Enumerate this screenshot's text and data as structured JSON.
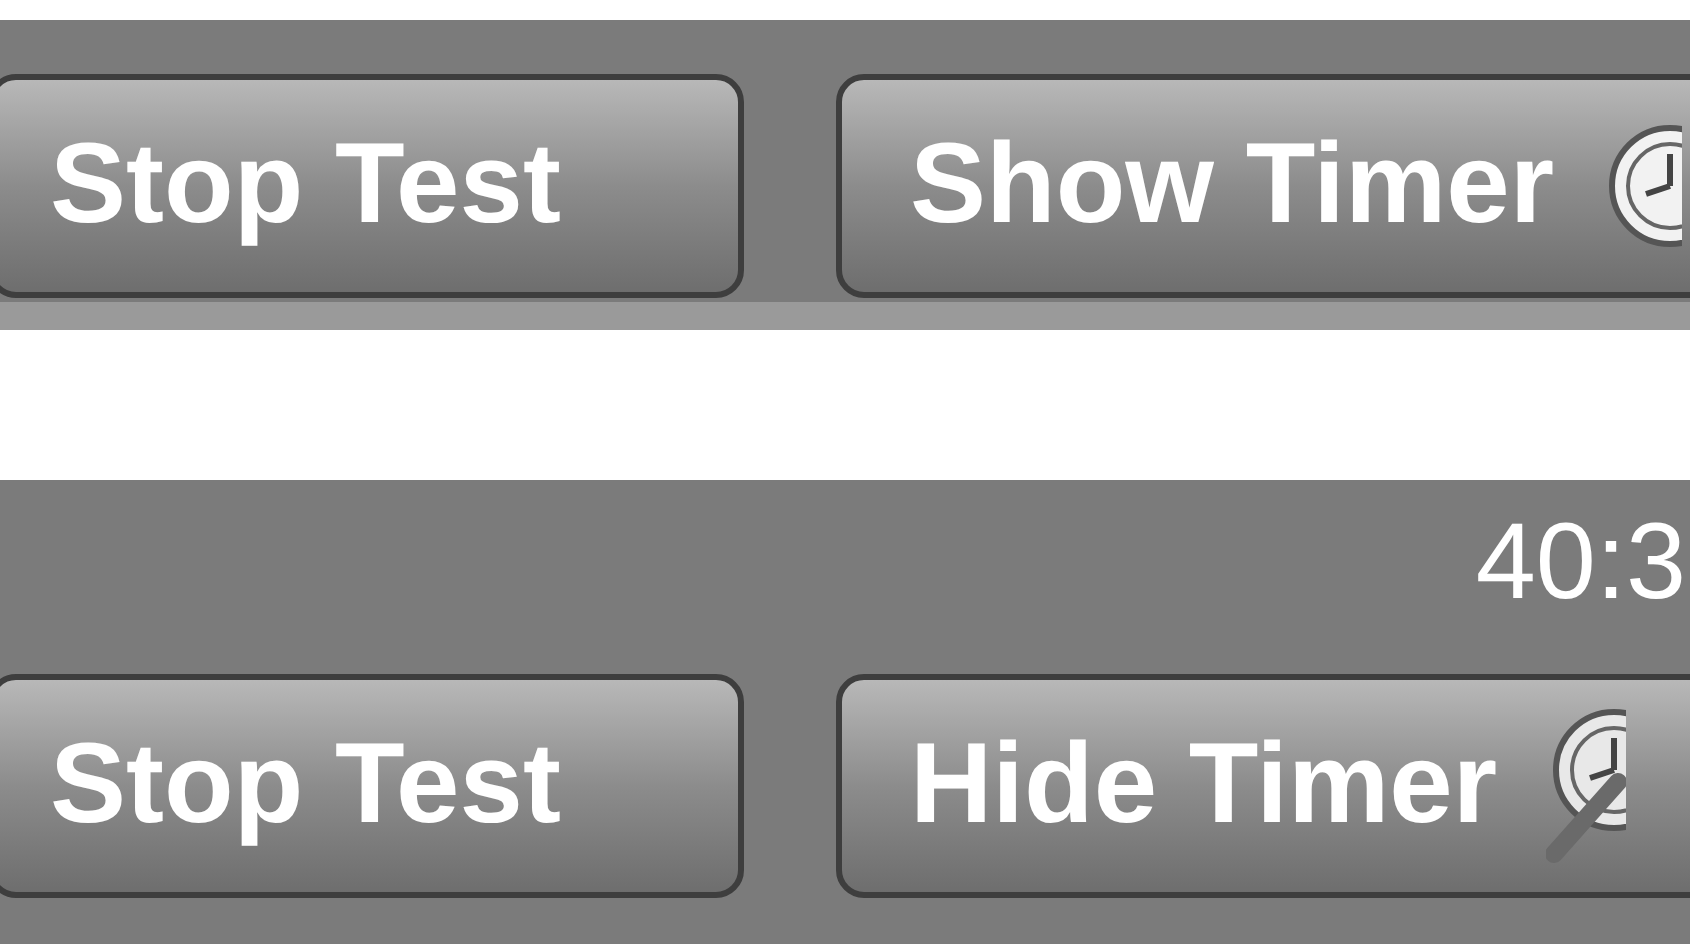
{
  "panels": [
    {
      "buttons": [
        {
          "label": "Stop Test",
          "kind": "plain"
        },
        {
          "label": "Show Timer",
          "kind": "clock"
        }
      ]
    },
    {
      "timer_reading": "40:3",
      "buttons": [
        {
          "label": "Stop Test",
          "kind": "plain"
        },
        {
          "label": "Hide Timer",
          "kind": "clock-off"
        }
      ]
    }
  ]
}
